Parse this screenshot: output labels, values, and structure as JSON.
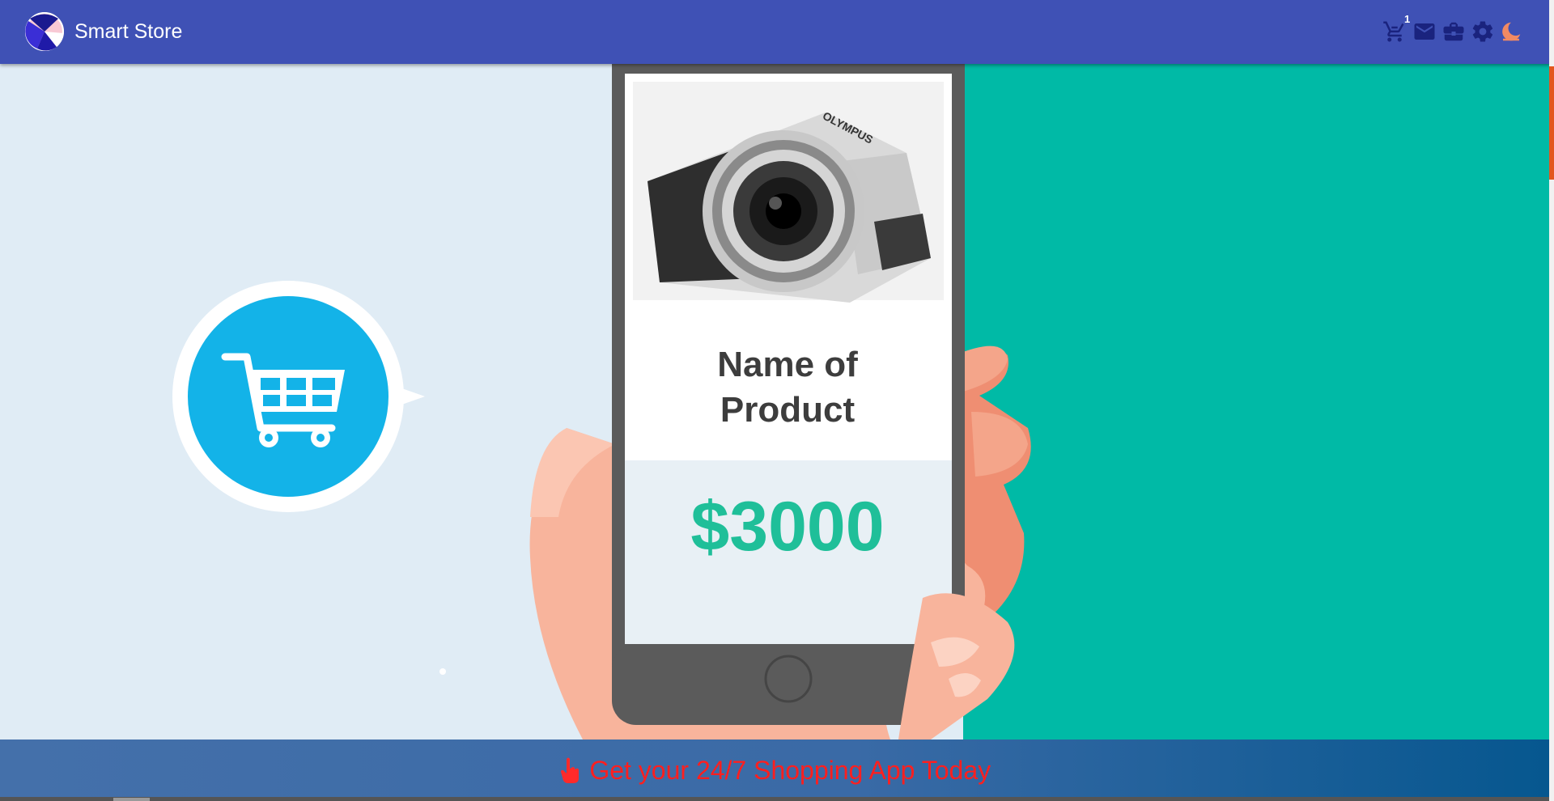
{
  "header": {
    "brand": "Smart Store",
    "cart_count": "1",
    "icons": [
      "cart-icon",
      "mail-icon",
      "briefcase-icon",
      "gear-icon",
      "moon-icon"
    ]
  },
  "hero": {
    "product_name": "Name of\nProduct",
    "product_price": "$3000",
    "camera_brand": "OLYMPUS"
  },
  "banner": {
    "text": "Get your 24/7 Shopping App Today",
    "icon": "tap-hand-icon"
  },
  "colors": {
    "header": "#3f51b5",
    "hero_left": "#e0ecf5",
    "hero_right": "#00baa6",
    "cart_circle": "#13b3e8",
    "price": "#1fbf99",
    "banner_text": "#ff1f1f",
    "scroll_accent": "#e2571e"
  }
}
